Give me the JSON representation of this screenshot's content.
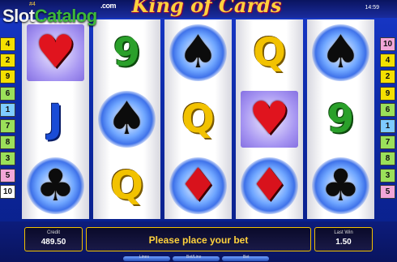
{
  "watermark": {
    "part1": "Slot",
    "part2": "Catalog",
    "suffix": ".com"
  },
  "title": "King of Cards",
  "top_mark": "#4",
  "clock": "14:59",
  "line_markers": {
    "left": [
      {
        "label": "4",
        "color": "#f4e000"
      },
      {
        "label": "2",
        "color": "#f4e000"
      },
      {
        "label": "9",
        "color": "#f4e000"
      },
      {
        "label": "6",
        "color": "#9be05a"
      },
      {
        "label": "1",
        "color": "#7ecbff"
      },
      {
        "label": "7",
        "color": "#9be05a"
      },
      {
        "label": "8",
        "color": "#9be05a"
      },
      {
        "label": "3",
        "color": "#9be05a"
      },
      {
        "label": "5",
        "color": "#f2a6d8"
      },
      {
        "label": "10",
        "color": "#ffffff"
      }
    ],
    "right": [
      {
        "label": "10",
        "color": "#f2a6d8"
      },
      {
        "label": "4",
        "color": "#f4e000"
      },
      {
        "label": "2",
        "color": "#f4e000"
      },
      {
        "label": "9",
        "color": "#f4e000"
      },
      {
        "label": "6",
        "color": "#9be05a"
      },
      {
        "label": "1",
        "color": "#7ecbff"
      },
      {
        "label": "7",
        "color": "#9be05a"
      },
      {
        "label": "8",
        "color": "#9be05a"
      },
      {
        "label": "3",
        "color": "#9be05a"
      },
      {
        "label": "5",
        "color": "#f2a6d8"
      }
    ]
  },
  "reels": [
    [
      {
        "symbol": "heart",
        "glyph": "♥",
        "highlight": "square"
      },
      {
        "symbol": "jack",
        "glyph": "J",
        "highlight": "none"
      },
      {
        "symbol": "club",
        "glyph": "♣",
        "highlight": "blue"
      }
    ],
    [
      {
        "symbol": "nine",
        "glyph": "9",
        "highlight": "none"
      },
      {
        "symbol": "spade",
        "glyph": "♠",
        "highlight": "blue"
      },
      {
        "symbol": "queen",
        "glyph": "Q",
        "highlight": "none"
      }
    ],
    [
      {
        "symbol": "spade",
        "glyph": "♠",
        "highlight": "blue"
      },
      {
        "symbol": "queen",
        "glyph": "Q",
        "highlight": "none"
      },
      {
        "symbol": "diamond",
        "glyph": "♦",
        "highlight": "blue"
      }
    ],
    [
      {
        "symbol": "queen",
        "glyph": "Q",
        "highlight": "none"
      },
      {
        "symbol": "heart",
        "glyph": "♥",
        "highlight": "square"
      },
      {
        "symbol": "diamond",
        "glyph": "♦",
        "highlight": "blue"
      }
    ],
    [
      {
        "symbol": "spade",
        "glyph": "♠",
        "highlight": "blue"
      },
      {
        "symbol": "nine",
        "glyph": "9",
        "highlight": "none"
      },
      {
        "symbol": "club",
        "glyph": "♣",
        "highlight": "blue"
      }
    ]
  ],
  "panel": {
    "credit_label": "Credit",
    "credit_value": "489.50",
    "message": "Please place your bet",
    "win_label": "Last Win",
    "win_value": "1.50",
    "lines_label": "Lines",
    "betline_label": "Bet/Line",
    "bet_label": "Bet"
  }
}
